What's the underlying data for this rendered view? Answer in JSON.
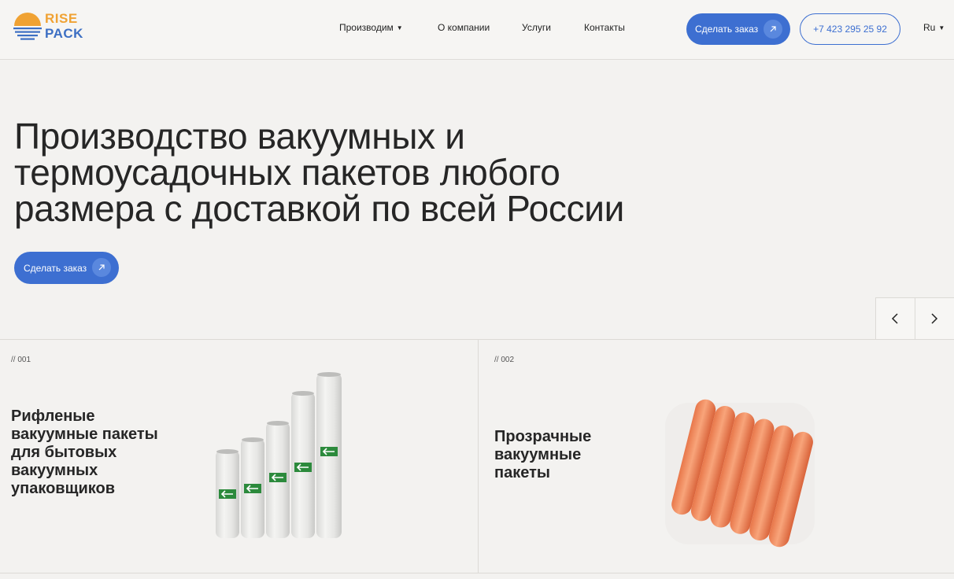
{
  "header": {
    "logo_line1": "RISE",
    "logo_line2": "PACK",
    "nav": [
      {
        "label": "Производим",
        "has_dropdown": true
      },
      {
        "label": "О компании",
        "has_dropdown": false
      },
      {
        "label": "Услуги",
        "has_dropdown": false
      },
      {
        "label": "Контакты",
        "has_dropdown": false
      }
    ],
    "order_button": "Сделать заказ",
    "phone": "+7 423 295 25 92",
    "language": "Ru"
  },
  "hero": {
    "title_lines": [
      "Производство вакуумных и",
      "термоусадочных пакетов любого",
      "размера с доставкой по всей России"
    ],
    "order_button": "Сделать заказ"
  },
  "products": [
    {
      "number": "// 001",
      "title_lines": [
        "Рифленые",
        "вакуумные пакеты",
        "для бытовых",
        "вакуумных",
        "упаковщиков"
      ],
      "image_icon": "vacuum-rolls-image"
    },
    {
      "number": "// 002",
      "title_lines": [
        "Прозрачные",
        "вакуумные",
        "пакеты"
      ],
      "image_icon": "vacuum-packed-sausages-image"
    }
  ],
  "colors": {
    "accent_blue": "#3d6fd1",
    "logo_orange": "#f0a233",
    "logo_blue": "#3d6fc3",
    "background": "#f3f2f0"
  }
}
